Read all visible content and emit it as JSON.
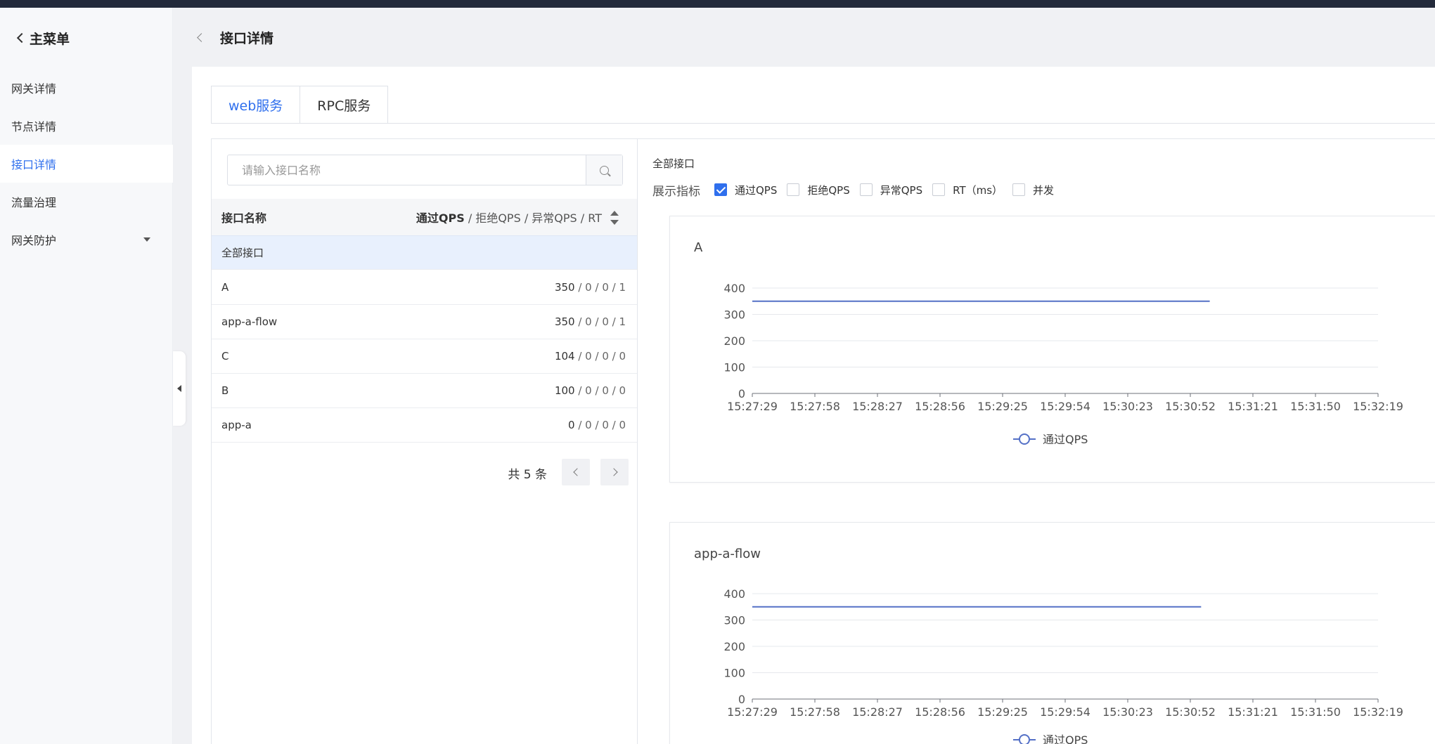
{
  "sidebar": {
    "back_label": "主菜单",
    "items": [
      {
        "label": "网关详情",
        "active": false
      },
      {
        "label": "节点详情",
        "active": false
      },
      {
        "label": "接口详情",
        "active": true
      },
      {
        "label": "流量治理",
        "active": false
      },
      {
        "label": "网关防护",
        "active": false,
        "expandable": true
      }
    ]
  },
  "header": {
    "title": "接口详情"
  },
  "tabs": [
    {
      "label": "web服务",
      "active": true
    },
    {
      "label": "RPC服务",
      "active": false
    }
  ],
  "list": {
    "search_placeholder": "请输入接口名称",
    "col_name": "接口名称",
    "col_metrics": {
      "pass": "通过QPS",
      "sep": " / ",
      "reject": "拒绝QPS",
      "exception": "异常QPS",
      "rt": "RT"
    },
    "all_row": "全部接口",
    "rows": [
      {
        "name": "A",
        "pass": "350",
        "rest": " / 0 / 0 / 1"
      },
      {
        "name": "app-a-flow",
        "pass": "350",
        "rest": " / 0 / 0 / 1"
      },
      {
        "name": "C",
        "pass": "104",
        "rest": " / 0 / 0 / 0"
      },
      {
        "name": "B",
        "pass": "100",
        "rest": " / 0 / 0 / 0"
      },
      {
        "name": "app-a",
        "pass": "0",
        "rest": " / 0 / 0 / 0"
      }
    ],
    "total_text": "共 5 条"
  },
  "chart_panel": {
    "title": "全部接口",
    "metrics_label": "展示指标",
    "metrics": [
      {
        "label": "通过QPS",
        "checked": true
      },
      {
        "label": "拒绝QPS",
        "checked": false
      },
      {
        "label": "异常QPS",
        "checked": false
      },
      {
        "label": "RT（ms）",
        "checked": false
      },
      {
        "label": "并发",
        "checked": false
      }
    ],
    "line_color": "#5470c6"
  },
  "chart_data": [
    {
      "type": "line",
      "title": "A",
      "x_ticks": [
        "15:27:29",
        "15:27:58",
        "15:28:27",
        "15:28:56",
        "15:29:25",
        "15:29:54",
        "15:30:23",
        "15:30:52",
        "15:31:21",
        "15:31:50",
        "15:32:19"
      ],
      "y_ticks": [
        0,
        100,
        200,
        300,
        400
      ],
      "ylim": [
        0,
        400
      ],
      "xlim": [
        "15:27:29",
        "15:32:19"
      ],
      "grid": true,
      "legend_position": "bottom",
      "series": [
        {
          "name": "通过QPS",
          "x": [
            "15:27:29",
            "15:28:27",
            "15:29:25",
            "15:30:23",
            "15:31:01"
          ],
          "y": [
            350,
            350,
            350,
            350,
            350
          ]
        }
      ]
    },
    {
      "type": "line",
      "title": "app-a-flow",
      "x_ticks": [
        "15:27:29",
        "15:27:58",
        "15:28:27",
        "15:28:56",
        "15:29:25",
        "15:29:54",
        "15:30:23",
        "15:30:52",
        "15:31:21",
        "15:31:50",
        "15:32:19"
      ],
      "y_ticks": [
        0,
        100,
        200,
        300,
        400
      ],
      "ylim": [
        0,
        400
      ],
      "xlim": [
        "15:27:29",
        "15:32:19"
      ],
      "grid": true,
      "legend_position": "bottom",
      "series": [
        {
          "name": "通过QPS",
          "x": [
            "15:27:29",
            "15:28:27",
            "15:29:25",
            "15:30:23",
            "15:30:57"
          ],
          "y": [
            350,
            350,
            350,
            350,
            350
          ]
        }
      ]
    }
  ]
}
